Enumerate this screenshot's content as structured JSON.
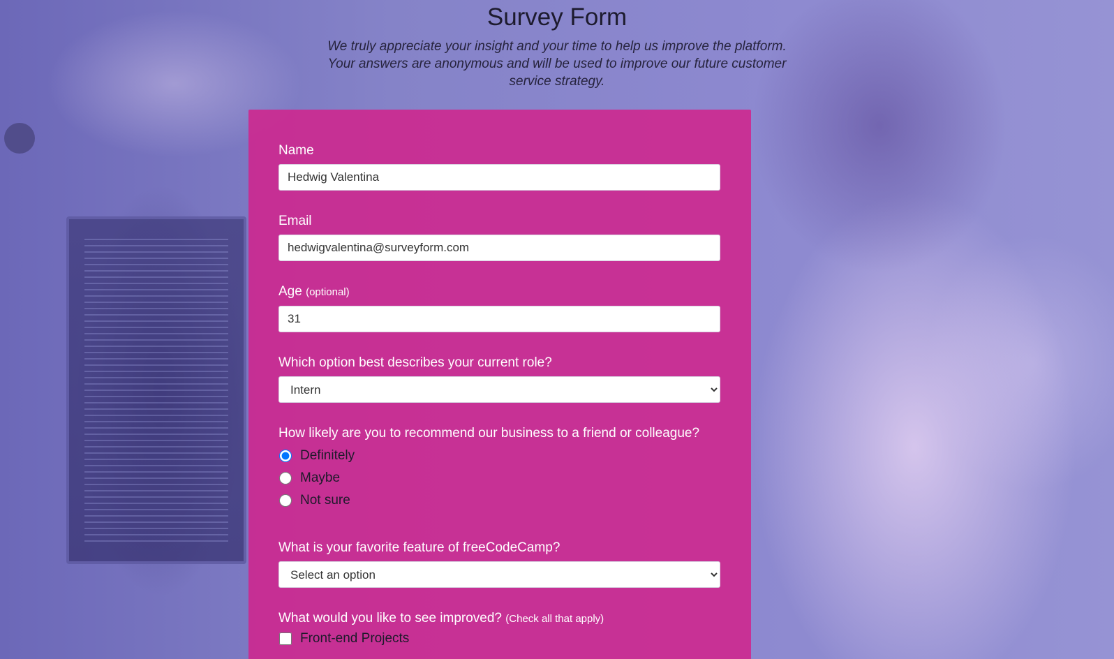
{
  "header": {
    "title": "Survey Form",
    "description": "We truly appreciate your insight and your time to help us improve the platform. Your answers are anonymous and will be used to improve our future customer service strategy."
  },
  "form": {
    "name": {
      "label": "Name",
      "value": "Hedwig Valentina"
    },
    "email": {
      "label": "Email",
      "value": "hedwigvalentina@surveyform.com"
    },
    "age": {
      "label": "Age",
      "clue": "(optional)",
      "value": "31"
    },
    "role": {
      "label": "Which option best describes your current role?",
      "selected": "Intern"
    },
    "recommend": {
      "label": "How likely are you to recommend our business to a friend or colleague?",
      "options": [
        "Definitely",
        "Maybe",
        "Not sure"
      ],
      "selected": "Definitely"
    },
    "favorite_feature": {
      "label": "What is your favorite feature of freeCodeCamp?",
      "selected": "Select an option"
    },
    "improvements": {
      "label": "What would you like to see improved?",
      "clue": "(Check all that apply)",
      "options": [
        "Front-end Projects"
      ]
    }
  },
  "colors": {
    "form_background": "#d2238c",
    "page_overlay": "#8583c8",
    "label_text": "#ffffff",
    "question_text": "#1d1a2a"
  },
  "icons": {
    "select_arrow": "chevron-down-icon"
  }
}
